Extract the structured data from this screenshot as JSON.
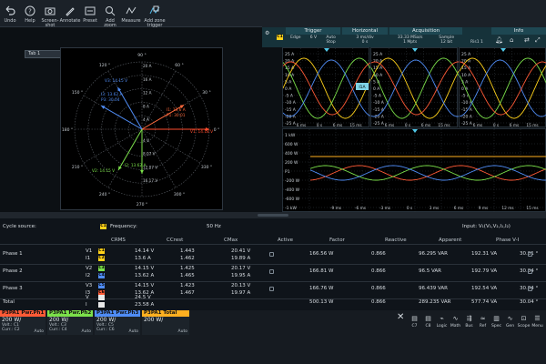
{
  "toolbar": {
    "undo": "Undo",
    "help": "Help",
    "screenshot": "Screen-\nshot",
    "annotate": "Annotate",
    "preset": "Preset",
    "add_zoom": "Add\nzoom",
    "measure": "Measure",
    "add_zone_trigger": "Add zone\ntrigger",
    "tab": "Tab 1"
  },
  "header": {
    "channel_badge": "C1",
    "trigger": {
      "title": "Trigger",
      "mode": "Edge",
      "level": "6 V",
      "sweep": "Auto",
      "state": "Stop"
    },
    "horizontal": {
      "title": "Horizontal",
      "scale": "3 ms/div",
      "position": "0 s"
    },
    "acquisition": {
      "title": "Acquisition",
      "rate": "33.33 MSa/s",
      "points": "1 Mpts",
      "mode": "Sample",
      "bits": "12 bit"
    },
    "extra": {
      "rise": "Ris1 1",
      "info": "Info"
    }
  },
  "polar": {
    "angles": [
      "0 °",
      "30 °",
      "60 °",
      "90 °",
      "120 °",
      "150 °",
      "180 °",
      "210 °",
      "240 °",
      "270 °",
      "300 °",
      "330 °"
    ],
    "rings_a": [
      "20 A",
      "16 A",
      "12 A",
      "8 A",
      "4 A"
    ],
    "rings_v": [
      "16.17 V",
      "12.07 V",
      "8.07 V",
      "4 V"
    ],
    "vectors": [
      {
        "label": "V1: 14.18 V",
        "color": "#ff4d2e"
      },
      {
        "label": "I1: 13.6 A",
        "color": "#ff6a3d"
      },
      {
        "label": "P1: 30.01",
        "color": "#ff6a3d"
      },
      {
        "label": "V3: 14.15 V",
        "color": "#4f8cf5"
      },
      {
        "label": "I3: 13.62 A",
        "color": "#4f8cf5"
      },
      {
        "label": "P3: 30.04",
        "color": "#4f8cf5"
      },
      {
        "label": "V2: 14.15 V",
        "color": "#7be04a"
      },
      {
        "label": "I2: 13.62 A",
        "color": "#7be04a"
      }
    ]
  },
  "current_panels": {
    "ticks_y": [
      "25 A",
      "20 A",
      "15 A",
      "10 A",
      "5 A",
      "0 A",
      "-5 A",
      "-10 A",
      "-15 A",
      "-20 A",
      "-25 A"
    ],
    "ticks_x": [
      "6 ms",
      "0 s",
      "6 ms",
      "15 ms"
    ],
    "marker": "I1A"
  },
  "power_panel": {
    "ticks_y": [
      "1 kW",
      "600 W",
      "400 W",
      "200 W",
      "P1",
      "-200 W",
      "-400 W",
      "-600 W",
      "-1 kW"
    ],
    "ticks_x": [
      "-9 ms",
      "-6 ms",
      "-3 ms",
      "0 s",
      "3 ms",
      "6 ms",
      "9 ms",
      "12 ms",
      "15 ms"
    ]
  },
  "table": {
    "cycle_source_label": "Cycle source:",
    "cycle_source_chip": "C1",
    "frequency_label": "Frequency:",
    "frequency_value": "50 Hz",
    "input_label": "Input: V₁(V₁,V₂,I₁,I₂)",
    "columns": [
      "CRMS",
      "CCrest",
      "CMax",
      "Active",
      "Factor",
      "Reactive",
      "Apparent",
      "Phase V-I"
    ],
    "phases": [
      {
        "name": "Phase 1",
        "v_name": "V1",
        "i_name": "I1",
        "v_chip": "C1",
        "i_chip": "C2",
        "v_rms": "14.14 V",
        "i_rms": "13.6 A",
        "v_crest": "1.443",
        "i_crest": "1.462",
        "v_max": "20.41 V",
        "i_max": "19.89 A",
        "active": "166.56 W",
        "factor": "0.866",
        "reactive": "96.295 VAR",
        "apparent": "192.31 VA",
        "phase": "30.01 °"
      },
      {
        "name": "Phase 2",
        "v_name": "V2",
        "i_name": "I2",
        "v_chip": "C3",
        "i_chip": "C4",
        "v_rms": "14.15 V",
        "i_rms": "13.62 A",
        "v_crest": "1.425",
        "i_crest": "1.465",
        "v_max": "20.17 V",
        "i_max": "19.95 A",
        "active": "166.81 W",
        "factor": "0.866",
        "reactive": "96.5 VAR",
        "apparent": "192.79 VA",
        "phase": "30.04 °"
      },
      {
        "name": "Phase 3",
        "v_name": "V3",
        "i_name": "I3",
        "v_chip": "C5",
        "i_chip": "C6",
        "v_rms": "14.15 V",
        "i_rms": "13.62 A",
        "v_crest": "1.423",
        "i_crest": "1.467",
        "v_max": "20.13 V",
        "i_max": "19.97 A",
        "active": "166.76 W",
        "factor": "0.866",
        "reactive": "96.439 VAR",
        "apparent": "192.54 VA",
        "phase": "30.04 °"
      }
    ],
    "total": {
      "name": "Total",
      "v_name": "V",
      "i_name": "I",
      "v_rms": "24.5 V",
      "i_rms": "23.58 A",
      "active": "500.13 W",
      "factor": "0.866",
      "reactive": "289.235 VAR",
      "apparent": "577.74 VA",
      "phase": "30.04 °"
    }
  },
  "signals": [
    {
      "name": "P3PA1 Pwr.Ph1",
      "color": "#ff5a36",
      "value": "200 W/",
      "sub1": "Volt.: C1",
      "sub2": "Curr.: C2",
      "mode": "Auto"
    },
    {
      "name": "P3PA1 Pwr.Ph2",
      "color": "#7be04a",
      "value": "200 W/",
      "sub1": "Volt.: C3",
      "sub2": "Curr.: C4",
      "mode": "Auto"
    },
    {
      "name": "P3PA1 Pwr.Ph3",
      "color": "#4f8cf5",
      "value": "200 W/",
      "sub1": "Volt.: C5",
      "sub2": "Curr.: C6",
      "mode": "Auto"
    },
    {
      "name": "P3PA1 Total",
      "color": "#ffb020",
      "value": "200 W/",
      "sub1": "",
      "sub2": "",
      "mode": "Auto"
    }
  ],
  "channels": [
    "C7",
    "C8",
    "Logic",
    "Math",
    "Bus",
    "Ref",
    "Spec",
    "Gen",
    "Scope",
    "Menu"
  ]
}
